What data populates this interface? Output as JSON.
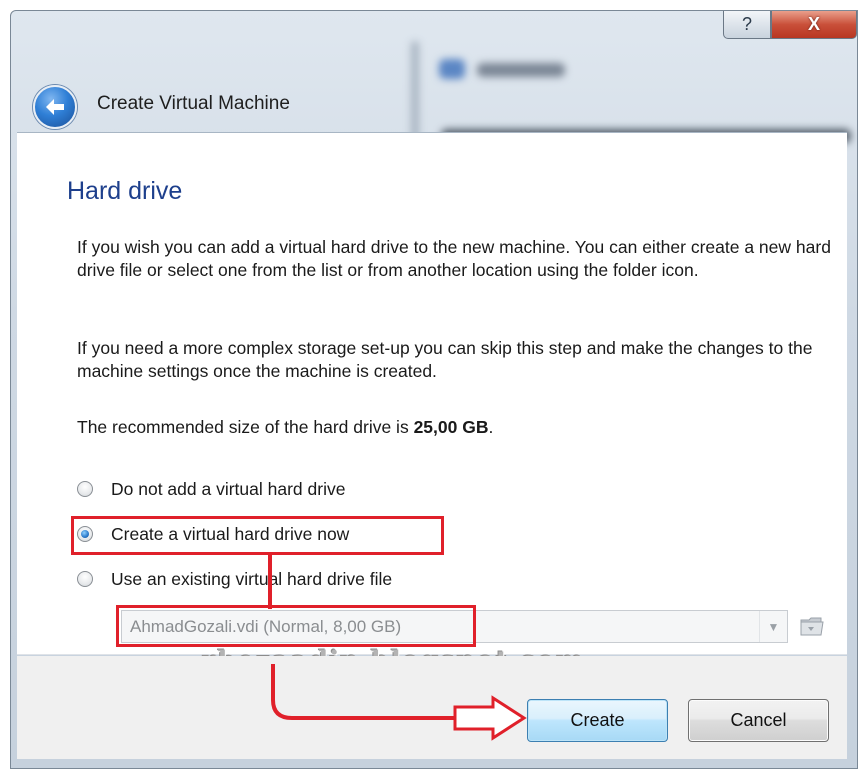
{
  "window": {
    "title": "Create Virtual Machine",
    "background_blur_label": "Preview",
    "help_glyph": "?",
    "close_glyph": "X"
  },
  "page": {
    "title": "Hard drive",
    "paragraph1": "If you wish you can add a virtual hard drive to the new machine. You can either create a new hard drive file or select one from the list or from another location using the folder icon.",
    "paragraph2": "If you need a more complex storage set-up you can skip this step and make the changes to the machine settings once the machine is created.",
    "recommended_prefix": "The recommended size of the hard drive is ",
    "recommended_size": "25,00 GB",
    "recommended_suffix": "."
  },
  "options": [
    {
      "label": "Do not add a virtual hard drive",
      "selected": false
    },
    {
      "label": "Create a virtual hard drive now",
      "selected": true
    },
    {
      "label": "Use an existing virtual hard drive file",
      "selected": false
    }
  ],
  "disk_select": {
    "value": "AhmadGozali.vdi (Normal, 8,00 GB)",
    "enabled": false
  },
  "watermark": "rhezaadip.blogspot.com",
  "buttons": {
    "create": "Create",
    "cancel": "Cancel"
  },
  "colors": {
    "title_blue": "#1d3f8c",
    "annotation_red": "#e0202a",
    "close_red": "#c9503a"
  },
  "icons": {
    "back": "back-arrow-icon",
    "help": "help-icon",
    "close": "close-icon",
    "folder": "folder-icon",
    "dropdown": "chevron-down-icon"
  }
}
